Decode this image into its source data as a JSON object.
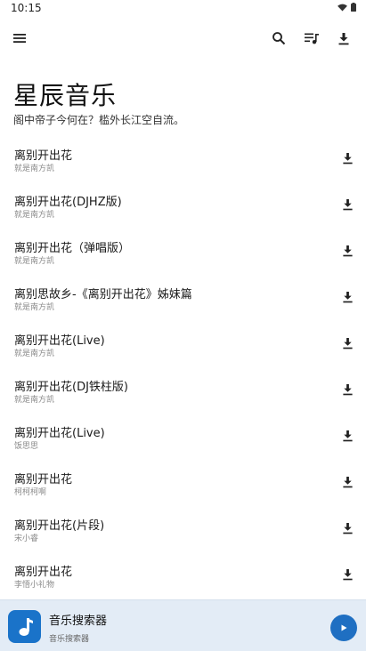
{
  "status": {
    "time": "10:15"
  },
  "header": {
    "title": "星辰音乐",
    "subtitle": "阁中帝子今何在？槛外长江空自流。"
  },
  "songs": [
    {
      "title": "离别开出花",
      "artist": "就是南方凯"
    },
    {
      "title": "离别开出花(DJHZ版)",
      "artist": "就是南方凯"
    },
    {
      "title": "离别开出花（弹唱版）",
      "artist": "就是南方凯"
    },
    {
      "title": "离别思故乡-《离别开出花》姊妹篇",
      "artist": "就是南方凯"
    },
    {
      "title": "离别开出花(Live)",
      "artist": "就是南方凯"
    },
    {
      "title": "离别开出花(DJ铁柱版)",
      "artist": "就是南方凯"
    },
    {
      "title": "离别开出花(Live)",
      "artist": "饭思思"
    },
    {
      "title": "离别开出花",
      "artist": "柯柯柯啊"
    },
    {
      "title": "离别开出花(片段)",
      "artist": "宋小睿"
    },
    {
      "title": "离别开出花",
      "artist": "李悟小礼物"
    }
  ],
  "player": {
    "title": "音乐搜索器",
    "subtitle": "音乐搜索器"
  },
  "colors": {
    "accent": "#1f6fc2",
    "player_bg": "#e3ecf6",
    "art_bg": "#1a73c9"
  },
  "icons": [
    "menu-icon",
    "search-icon",
    "playlist-icon",
    "download-icon",
    "music-note-icon",
    "play-icon"
  ]
}
